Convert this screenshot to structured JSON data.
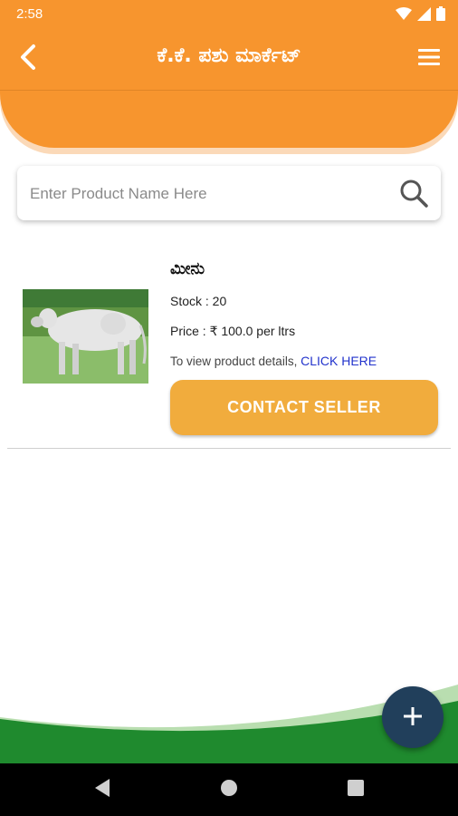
{
  "status_bar": {
    "time": "2:58"
  },
  "app_bar": {
    "title": "ಕೆ.ಕೆ. ಪಶು ಮಾರ್ಕೆಟ್"
  },
  "search": {
    "placeholder": "Enter Product Name Here",
    "value": ""
  },
  "products": [
    {
      "name": "ಮೀನು",
      "stock": "Stock : 20",
      "price": "Price : ₹ 100.0 per ltrs",
      "details_text": "To view product details, ",
      "details_link": "CLICK HERE",
      "contact_label": "CONTACT SELLER"
    }
  ],
  "colors": {
    "primary": "#f7952e",
    "button": "#f1ac3d",
    "fab": "#213f5b",
    "green": "#1f8a2e",
    "link": "#2233cc"
  },
  "icons": [
    "back-arrow-icon",
    "menu-icon",
    "search-icon",
    "plus-icon",
    "nav-back-icon",
    "nav-home-icon",
    "nav-recents-icon"
  ]
}
